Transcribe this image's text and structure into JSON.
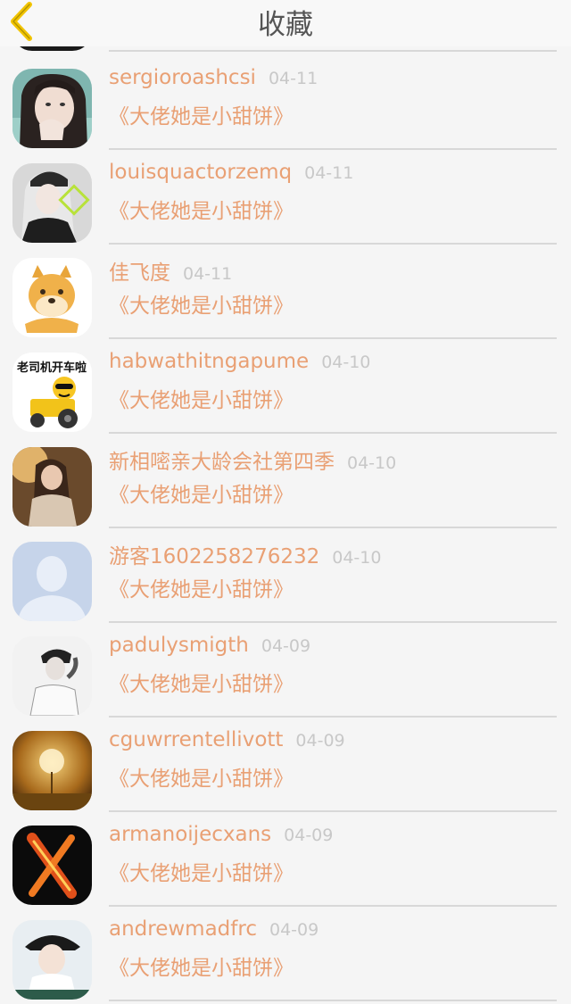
{
  "header": {
    "title": "收藏",
    "back_icon": "chevron-left-icon",
    "back_color": "#f2c400"
  },
  "colors": {
    "accent": "#e9a074",
    "date": "#c8c8c8",
    "divider": "#d8d8d8"
  },
  "items": [
    {
      "name": "sergioroashcsi",
      "date": "04-11",
      "book": "《大佬她是小甜饼》",
      "avatar": "girl-face-avatar"
    },
    {
      "name": "louisquactorzemq",
      "date": "04-11",
      "book": "《大佬她是小甜饼》",
      "avatar": "girl-cap-avatar"
    },
    {
      "name": "佳飞度",
      "date": "04-11",
      "book": "《大佬她是小甜饼》",
      "avatar": "doge-avatar"
    },
    {
      "name": "habwathitngapume",
      "date": "04-10",
      "book": "《大佬她是小甜饼》",
      "avatar": "tractor-emoji-avatar",
      "avatar_text": "老司机开车啦"
    },
    {
      "name": "新相嘧亲大龄会社第四季",
      "date": "04-10",
      "book": "《大佬她是小甜饼》",
      "avatar": "woman-sunset-avatar"
    },
    {
      "name": "游客1602258276232",
      "date": "04-10",
      "book": "《大佬她是小甜饼》",
      "avatar": "default-person-avatar"
    },
    {
      "name": "padulysmigth",
      "date": "04-09",
      "book": "《大佬她是小甜饼》",
      "avatar": "boy-bw-avatar"
    },
    {
      "name": "cguwrrentellivott",
      "date": "04-09",
      "book": "《大佬她是小甜饼》",
      "avatar": "dandelion-avatar"
    },
    {
      "name": "armanoijecxans",
      "date": "04-09",
      "book": "《大佬她是小甜饼》",
      "avatar": "fire-x-avatar"
    },
    {
      "name": "andrewmadfrc",
      "date": "04-09",
      "book": "《大佬她是小甜饼》",
      "avatar": "girl-hat-avatar"
    }
  ]
}
